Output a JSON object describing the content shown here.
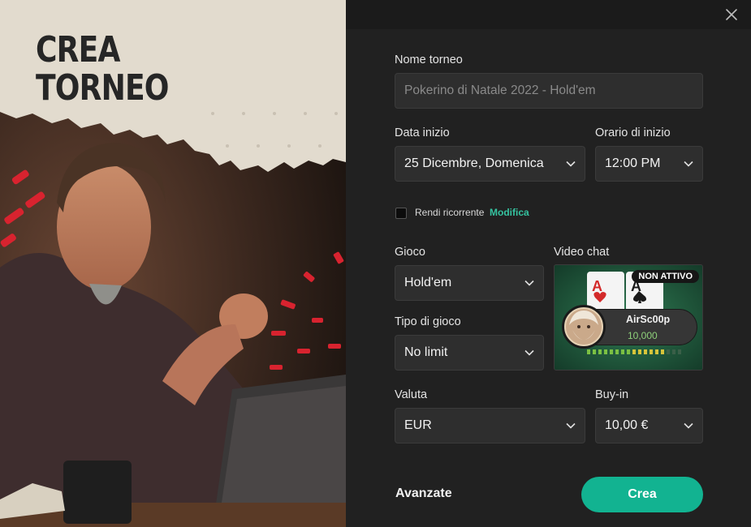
{
  "hero": {
    "title_line1": "CREA",
    "title_line2": "TORNEO"
  },
  "icons": {
    "close": "close-icon",
    "chevron": "chevron-down-icon"
  },
  "form": {
    "tournament_name": {
      "label": "Nome torneo",
      "placeholder": "Pokerino di Natale 2022 - Hold'em"
    },
    "start_date": {
      "label": "Data inizio",
      "value": "25 Dicembre, Domenica"
    },
    "start_time": {
      "label": "Orario di inizio",
      "value": "12:00 PM"
    },
    "recurring": {
      "label": "Rendi ricorrente",
      "link": "Modifica",
      "checked": false
    },
    "game": {
      "label": "Gioco",
      "value": "Hold'em"
    },
    "game_type": {
      "label": "Tipo di gioco",
      "value": "No limit"
    },
    "video_chat": {
      "label": "Video chat",
      "status": "NON ATTIVO",
      "player_name": "AirSc00p",
      "player_chips": "10,000"
    },
    "currency": {
      "label": "Valuta",
      "value": "EUR"
    },
    "buy_in": {
      "label": "Buy-in",
      "value": "10,00 €"
    }
  },
  "actions": {
    "advanced_label": "Avanzate",
    "create_label": "Crea"
  },
  "colors": {
    "accent": "#12b391",
    "link": "#35c3a0",
    "panel": "#212121",
    "field": "#2e2e2e"
  }
}
